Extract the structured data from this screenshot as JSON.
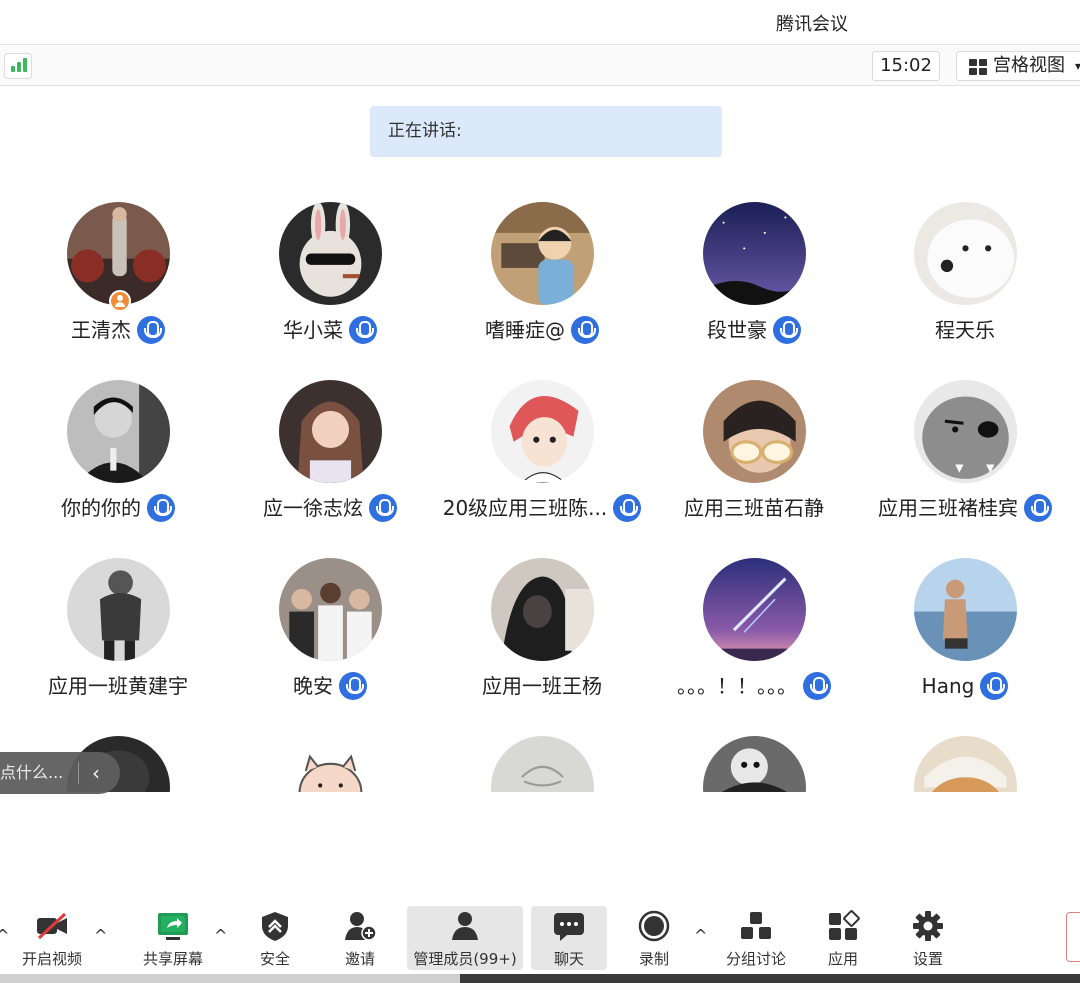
{
  "app": {
    "title": "腾讯会议"
  },
  "topbar": {
    "time": "15:02",
    "view_label": "宫格视图",
    "view_caret": "▾"
  },
  "speaking": {
    "label": "正在讲话:"
  },
  "participants": [
    {
      "name": "王清杰",
      "mic": true,
      "host": true,
      "avatar": "photo-girl-train"
    },
    {
      "name": "华小菜",
      "mic": true,
      "avatar": "rabbit-sunglasses"
    },
    {
      "name": "嗜睡症@",
      "mic": true,
      "avatar": "cartoon-boy-desk"
    },
    {
      "name": "段世豪",
      "mic": true,
      "avatar": "starry-night"
    },
    {
      "name": "程天乐",
      "mic": false,
      "avatar": "white-dog"
    },
    {
      "name": "你的你的",
      "mic": true,
      "avatar": "man-in-suit"
    },
    {
      "name": "应一徐志炫",
      "mic": true,
      "avatar": "girl-selfie"
    },
    {
      "name": "20级应用三班陈...",
      "mic": true,
      "avatar": "anime-red-hair"
    },
    {
      "name": "应用三班苗石静",
      "mic": false,
      "avatar": "sunglasses-selfie"
    },
    {
      "name": "应用三班褚桂宾",
      "mic": true,
      "avatar": "grey-cartoon-bear"
    },
    {
      "name": "应用一班黄建宇",
      "mic": false,
      "avatar": "boy-bw-photo"
    },
    {
      "name": "晚安",
      "mic": true,
      "avatar": "group-photo"
    },
    {
      "name": "应用一班王杨",
      "mic": false,
      "avatar": "hooded-figure"
    },
    {
      "name": "。。。！！。。。",
      "mic": true,
      "avatar": "comet-sky"
    },
    {
      "name": "Hang",
      "mic": true,
      "avatar": "man-at-beach"
    }
  ],
  "partial_row_avatars": [
    "dark-avatar",
    "pig-cartoon",
    "sketch-eye",
    "plush-toy",
    "shiba-dog"
  ],
  "chat": {
    "placeholder": "点什么...",
    "collapse_icon": "‹"
  },
  "toolbar": {
    "video": "开启视频",
    "share": "共享屏幕",
    "security": "安全",
    "invite": "邀请",
    "members": "管理成员(99+)",
    "chat": "聊天",
    "record": "录制",
    "breakout": "分组讨论",
    "apps": "应用",
    "settings": "设置",
    "caret": "^"
  },
  "colors": {
    "accent": "#2f6fe0",
    "speaking_bg": "#dce9fb",
    "signal": "#3cb95f",
    "share_green": "#1f9d55"
  }
}
